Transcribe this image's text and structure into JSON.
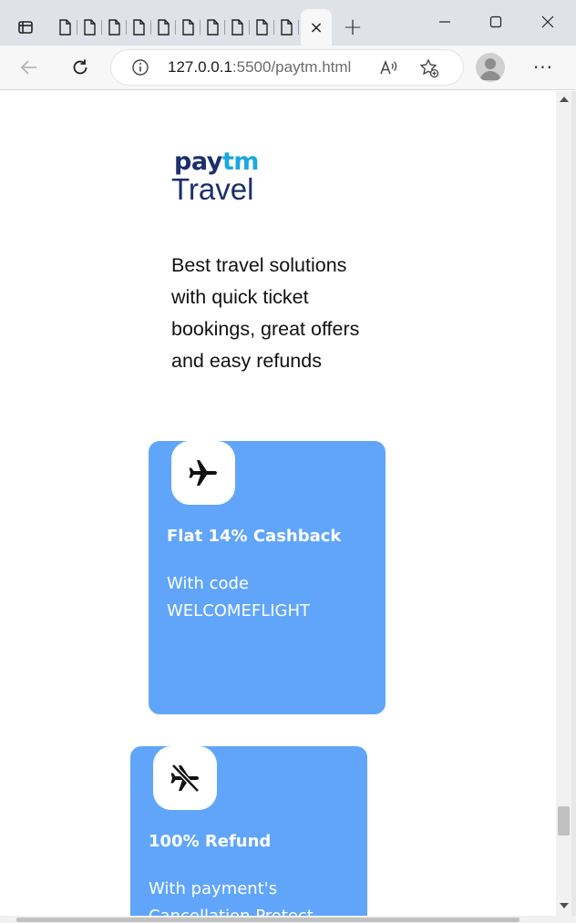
{
  "browser": {
    "address": {
      "host": "127.0.0.1",
      "path": ":5500/paytm.html"
    },
    "tabs": {
      "active_close_glyph": "×",
      "new_tab_glyph": "+"
    },
    "menu_glyph": "···"
  },
  "page": {
    "logo": {
      "brand_pay": "pay",
      "brand_tm": "tm",
      "product": "Travel",
      "colors": {
        "navy": "#1b2f6b",
        "cyan": "#1ca8e0"
      }
    },
    "tagline": "Best travel solutions with quick ticket bookings, great offers and easy refunds",
    "cards": [
      {
        "icon": "airplane-icon",
        "title": "Flat 14% Cashback",
        "description": "With code WELCOMEFLIGHT"
      },
      {
        "icon": "airplane-off-icon",
        "title": "100% Refund",
        "description": "With payment's Cancellation Protect"
      }
    ],
    "card_color": "#60a5fa"
  }
}
